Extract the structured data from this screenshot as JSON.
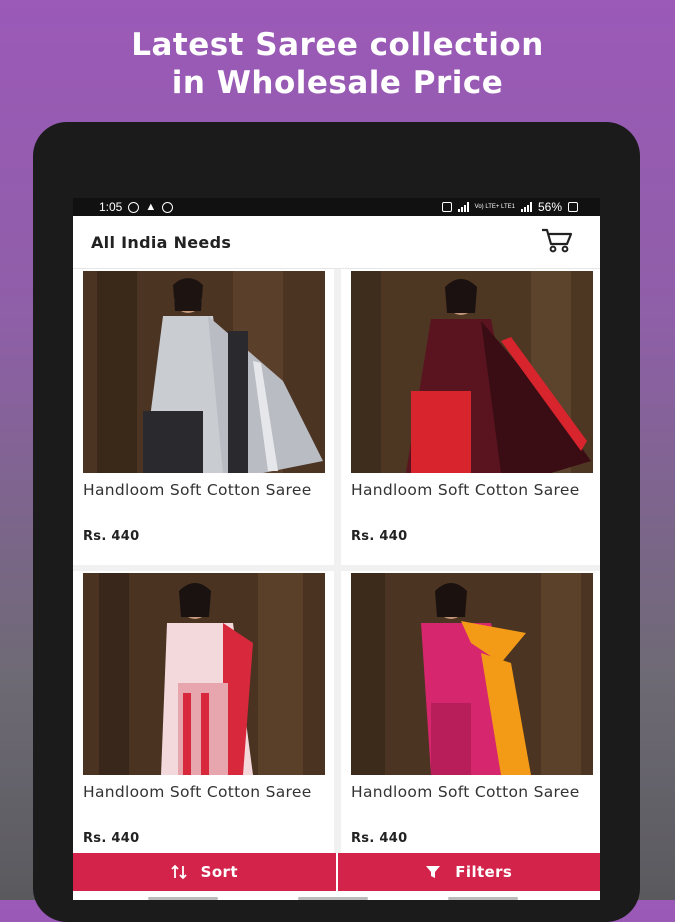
{
  "promo": {
    "line1": "Latest Saree collection",
    "line2": "in Wholesale Price"
  },
  "status_bar": {
    "time": "1:05",
    "battery": "56%",
    "network_label": "Vo) LTE+ LTE1"
  },
  "app_bar": {
    "title": "All India Needs",
    "cart_icon": "cart-icon"
  },
  "products": [
    {
      "name": "Handloom Soft Cotton Saree",
      "price": "Rs. 440",
      "colors": {
        "main": "#c9ccd1",
        "accent": "#2a2a2e"
      }
    },
    {
      "name": "Handloom Soft Cotton Saree",
      "price": "Rs. 440",
      "colors": {
        "main": "#5a1420",
        "accent": "#d8242c"
      }
    },
    {
      "name": "Handloom Soft Cotton Saree",
      "price": "Rs. 440",
      "colors": {
        "main": "#f3d9dc",
        "accent": "#d8283c"
      }
    },
    {
      "name": "Handloom Soft Cotton Saree",
      "price": "Rs. 440",
      "colors": {
        "main": "#d6266e",
        "accent": "#f39a16"
      }
    }
  ],
  "bottom_bar": {
    "sort_label": "Sort",
    "filters_label": "Filters"
  },
  "colors": {
    "accent": "#d3234a",
    "fab": "#e0304f"
  }
}
